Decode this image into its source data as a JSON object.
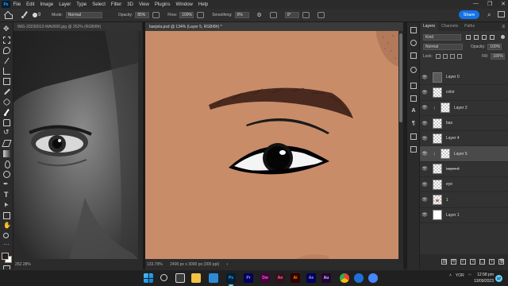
{
  "menu": {
    "logo": "Ps",
    "items": [
      "File",
      "Edit",
      "Image",
      "Layer",
      "Type",
      "Select",
      "Filter",
      "3D",
      "View",
      "Plugins",
      "Window",
      "Help"
    ],
    "window_controls": [
      "—",
      "❐",
      "✕"
    ]
  },
  "options": {
    "brush_size": "9",
    "mode_label": "Mode:",
    "mode_value": "Normal",
    "opacity_label": "Opacity:",
    "opacity_value": "85%",
    "flow_label": "Flow:",
    "flow_value": "100%",
    "smoothing_label": "Smoothing:",
    "smoothing_value": "0%",
    "angle_value": "0°",
    "share_label": "Share"
  },
  "doc1": {
    "tab_title": "IMG-20230913-WA0000.jpg @ 252% (RGB/8#)",
    "zoom": "252.28%"
  },
  "doc2": {
    "tab_title": "banjela.psd @ 134% (Layer 5, RGB/8#) *",
    "zoom": "133.79%",
    "dimensions": "2400 px x 3000 px (300 ppi)",
    "skin_color": "#c98c69"
  },
  "layers_panel": {
    "tabs": [
      "Layers",
      "Channels",
      "Paths"
    ],
    "kind_label": "Kind",
    "blend_mode": "Normal",
    "opacity_label": "Opacity:",
    "opacity_value": "100%",
    "lock_label": "Lock:",
    "fill_label": "Fill:",
    "fill_value": "100%",
    "layers": [
      {
        "name": "Layer 0",
        "thumb": "photo",
        "clip": "",
        "strike": false
      },
      {
        "name": "color",
        "thumb": "checker",
        "clip": "",
        "strike": false
      },
      {
        "name": "Layer 2",
        "thumb": "checker",
        "clip": "↓",
        "strike": false
      },
      {
        "name": "bas",
        "thumb": "checker",
        "clip": "",
        "strike": false
      },
      {
        "name": "Layer 4",
        "thumb": "checker",
        "clip": "",
        "strike": false
      },
      {
        "name": "Layer 5",
        "thumb": "checker",
        "clip": "↓",
        "strike": false
      },
      {
        "name": "Layer 3",
        "thumb": "checker",
        "clip": "",
        "strike": true
      },
      {
        "name": "eye",
        "thumb": "checker",
        "clip": "",
        "strike": false
      },
      {
        "name": "1",
        "thumb": "eye",
        "clip": "",
        "strike": false
      },
      {
        "name": "Layer 1",
        "thumb": "white",
        "clip": "",
        "strike": false
      }
    ],
    "footer_buttons": [
      "⛓",
      "fx",
      "◐",
      "◑",
      "▢",
      "+",
      "🗑"
    ]
  },
  "taskbar": {
    "apps": [
      "Ps",
      "Pr",
      "Dw",
      "An",
      "Ai",
      "Ae",
      "Au"
    ],
    "tray_lang": "YOR",
    "time": "12:58 pm",
    "date": "13/09/2023",
    "notifications": "17"
  }
}
